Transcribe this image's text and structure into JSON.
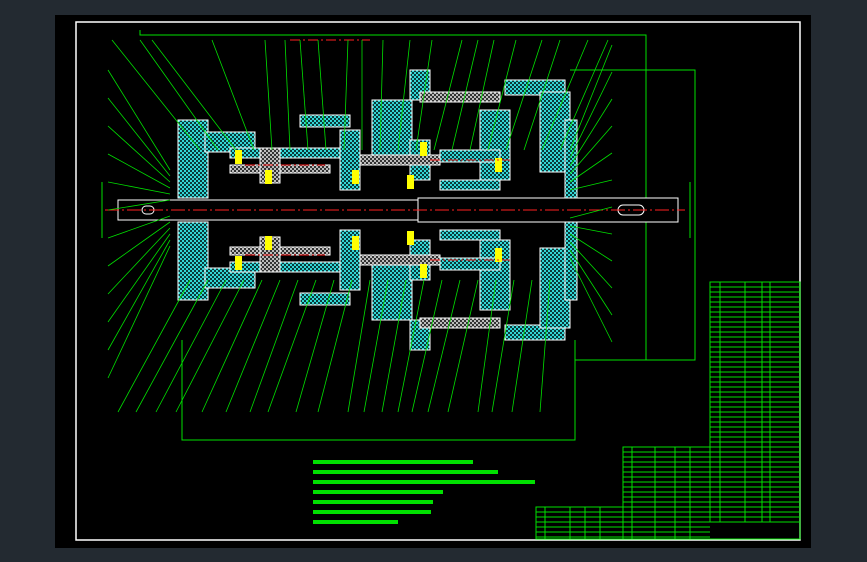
{
  "drawing": {
    "type": "CAD assembly drawing (planetary gearbox, section view)",
    "colors": {
      "background": "#000000",
      "outline": "#ffffff",
      "hatch": "#33d6d6",
      "leader_lines": "#00e000",
      "centerline": "#ff2020",
      "bearing_fill": "#ffff00",
      "viewport": "#232a31"
    },
    "notes_legible": false,
    "notes_line_count": 7,
    "parts_list_legible": false
  }
}
